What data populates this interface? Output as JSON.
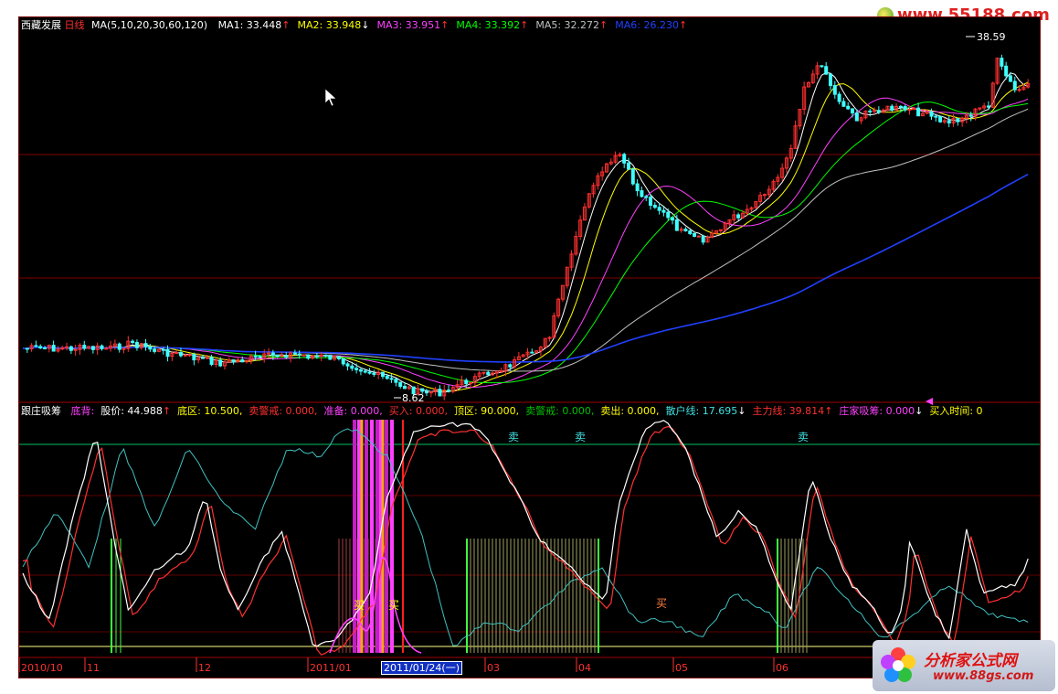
{
  "watermark_top": {
    "site": "www.55188.com"
  },
  "watermark_bottom": {
    "brand": "分析家公式网",
    "url": "www.88gs.com"
  },
  "price_panel": {
    "stock_name": "西藏发展",
    "period": "日线",
    "ma_params": "MA(5,10,20,30,60,120)",
    "ma_values": [
      {
        "label": "MA1: 33.448",
        "arrow": "↑",
        "color": "#ffffff"
      },
      {
        "label": "MA2: 33.948",
        "arrow": "↓",
        "color": "#ffff00"
      },
      {
        "label": "MA3: 33.951",
        "arrow": "↑",
        "color": "#ff40ff"
      },
      {
        "label": "MA4: 33.392",
        "arrow": "↑",
        "color": "#00ff00"
      },
      {
        "label": "MA5: 32.272",
        "arrow": "↑",
        "color": "#c0c0c0"
      },
      {
        "label": "MA6: 26.230",
        "arrow": "↑",
        "color": "#2040ff"
      }
    ],
    "high_label": "38.59",
    "low_label": "8.62"
  },
  "indicator_panel": {
    "name": "跟庄吸筹",
    "fields": [
      {
        "text": "底背:",
        "color": "#ff40ff"
      },
      {
        "text": "股价: 44.988",
        "color": "#ffffff",
        "arrow": "↑",
        "arrow_color": "#ff3030"
      },
      {
        "text": "底区: 10.500",
        "color": "#ffff00",
        "arrow": ",",
        "arrow_color": "#ffff00"
      },
      {
        "text": "卖警戒: 0.000,",
        "color": "#ff3030"
      },
      {
        "text": "准备: 0.000,",
        "color": "#ff40ff"
      },
      {
        "text": "买入: 0.000,",
        "color": "#ff3030"
      },
      {
        "text": "顶区: 90.000,",
        "color": "#ffff00"
      },
      {
        "text": "卖警戒: 0.000,",
        "color": "#00c000"
      },
      {
        "text": "卖出: 0.000,",
        "color": "#ffff00"
      },
      {
        "text": "散户线: 17.695",
        "color": "#40e0e0",
        "arrow": "↓",
        "arrow_color": "#ffffff"
      },
      {
        "text": "主力线: 39.814",
        "color": "#ff3030",
        "arrow": "↑",
        "arrow_color": "#ff3030"
      },
      {
        "text": "庄家吸筹: 0.000",
        "color": "#ff40ff",
        "arrow": "↓",
        "arrow_color": "#ffffff"
      },
      {
        "text": "买入时间: 0",
        "color": "#ffff00"
      }
    ],
    "signals": [
      {
        "text": "卖",
        "color": "#40e0e0"
      },
      {
        "text": "卖",
        "color": "#40e0e0"
      },
      {
        "text": "卖",
        "color": "#40e0e0"
      },
      {
        "text": "买",
        "color": "#ffff00"
      },
      {
        "text": "买",
        "color": "#ffff00"
      },
      {
        "text": "买",
        "color": "#ff8040"
      }
    ]
  },
  "date_axis": {
    "labels": [
      "2010/10",
      "11",
      "12",
      "2011/01",
      "03",
      "04",
      "05",
      "06"
    ],
    "cursor_date": "2011/01/24(一)"
  },
  "colors": {
    "up_candle": "#ff3030",
    "down_candle": "#40ffff",
    "grid": "#800000",
    "ma_slow": "#2040ff"
  }
}
